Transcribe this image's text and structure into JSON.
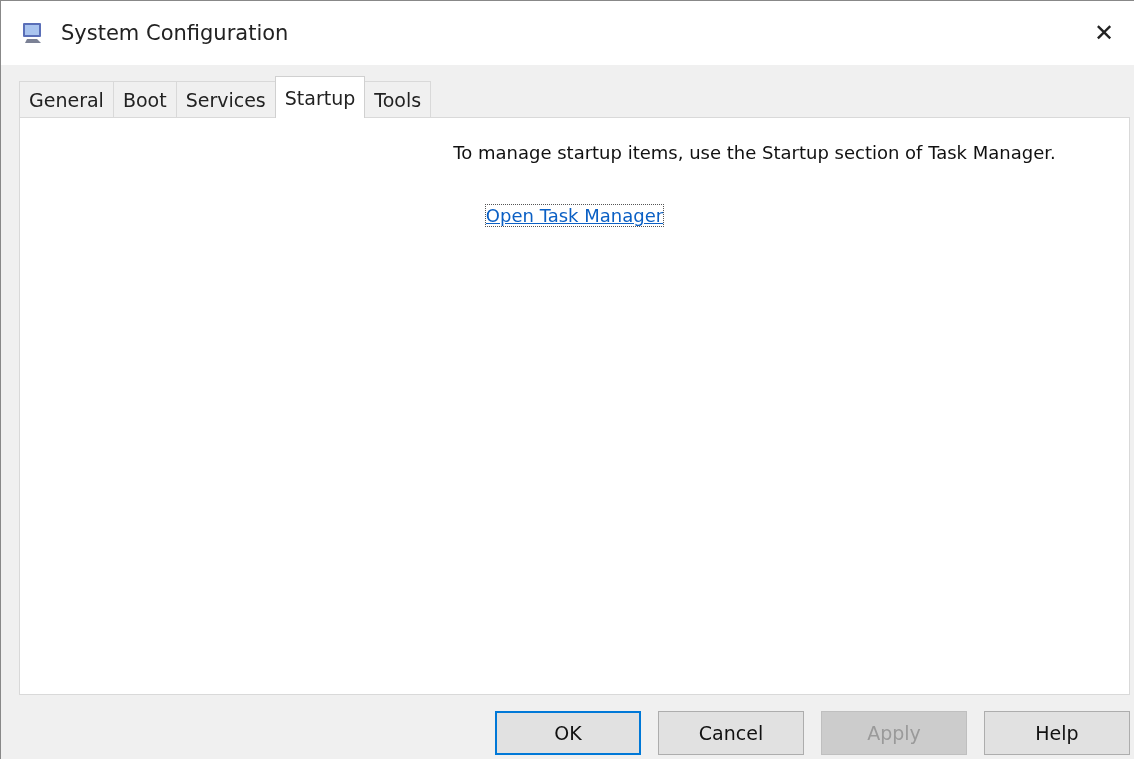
{
  "window": {
    "title": "System Configuration",
    "close": "✕"
  },
  "tabs": [
    {
      "label": "General",
      "selected": false
    },
    {
      "label": "Boot",
      "selected": false
    },
    {
      "label": "Services",
      "selected": false
    },
    {
      "label": "Startup",
      "selected": true
    },
    {
      "label": "Tools",
      "selected": false
    }
  ],
  "message": "To manage startup items, use the Startup section of Task Manager.",
  "link": "Open Task Manager",
  "buttons": [
    {
      "label": "OK",
      "default": true,
      "disabled": false
    },
    {
      "label": "Cancel",
      "default": false,
      "disabled": false
    },
    {
      "label": "Apply",
      "default": false,
      "disabled": true
    },
    {
      "label": "Help",
      "default": false,
      "disabled": false
    }
  ]
}
